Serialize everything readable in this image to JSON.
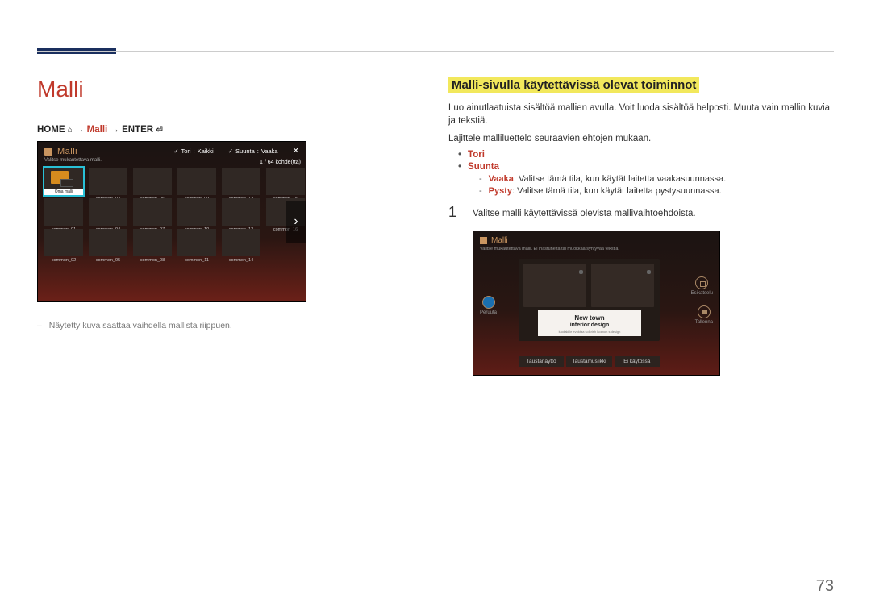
{
  "page_number": "73",
  "title": "Malli",
  "breadcrumb": {
    "home": "HOME",
    "arrow": "→",
    "mid": "Malli",
    "enter": "ENTER"
  },
  "screenshot1": {
    "title": "Malli",
    "subtitle": "Valitse mukautettava malli.",
    "filter_tori_label": "Tori",
    "filter_tori_value": "Kaikki",
    "filter_suunta_label": "Suunta",
    "filter_suunta_value": "Vaaka",
    "count": "1 / 64 kohde(tta)",
    "selected_label": "Oma malli",
    "grid_labels": [
      "common_01",
      "common_03",
      "common_06",
      "common_09",
      "common_12",
      "common_15",
      "common_01",
      "common_04",
      "common_07",
      "common_10",
      "common_13",
      "common_16",
      "common_02",
      "common_05",
      "common_08",
      "common_11",
      "common_14"
    ]
  },
  "note": "Näytetty kuva saattaa vaihdella mallista riippuen.",
  "section_title": "Malli-sivulla käytettävissä olevat toiminnot",
  "body1": "Luo ainutlaatuista sisältöä mallien avulla. Voit luoda sisältöä helposti. Muuta vain mallin kuvia ja tekstiä.",
  "body2": "Lajittele malliluettelo seuraavien ehtojen mukaan.",
  "bullets": {
    "tori": "Tori",
    "suunta": "Suunta",
    "vaaka_term": "Vaaka",
    "vaaka_text": ": Valitse tämä tila, kun käytät laitetta vaakasuunnassa.",
    "pysty_term": "Pysty",
    "pysty_text": ": Valitse tämä tila, kun käytät laitetta pystysuunnassa."
  },
  "step1_num": "1",
  "step1_text": "Valitse malli käytettävissä olevista mallivaihtoehdoista.",
  "screenshot2": {
    "title": "Malli",
    "subtitle": "Valitse mukautettava malli. Ei ihastuneita tai muokkaa syntyvää tekstiä.",
    "text_line1": "New town",
    "text_line2": "interior design",
    "text_line3": "luodakille evoktaa solkrish luomon s design",
    "left_btn": "Peruuta",
    "right_btn1": "Esikatselu",
    "right_btn2": "Tallenna",
    "bottom_btn1": "Taustanäyttö",
    "bottom_btn2": "Taustamusiikki",
    "bottom_btn3": "Ei käytössä"
  }
}
